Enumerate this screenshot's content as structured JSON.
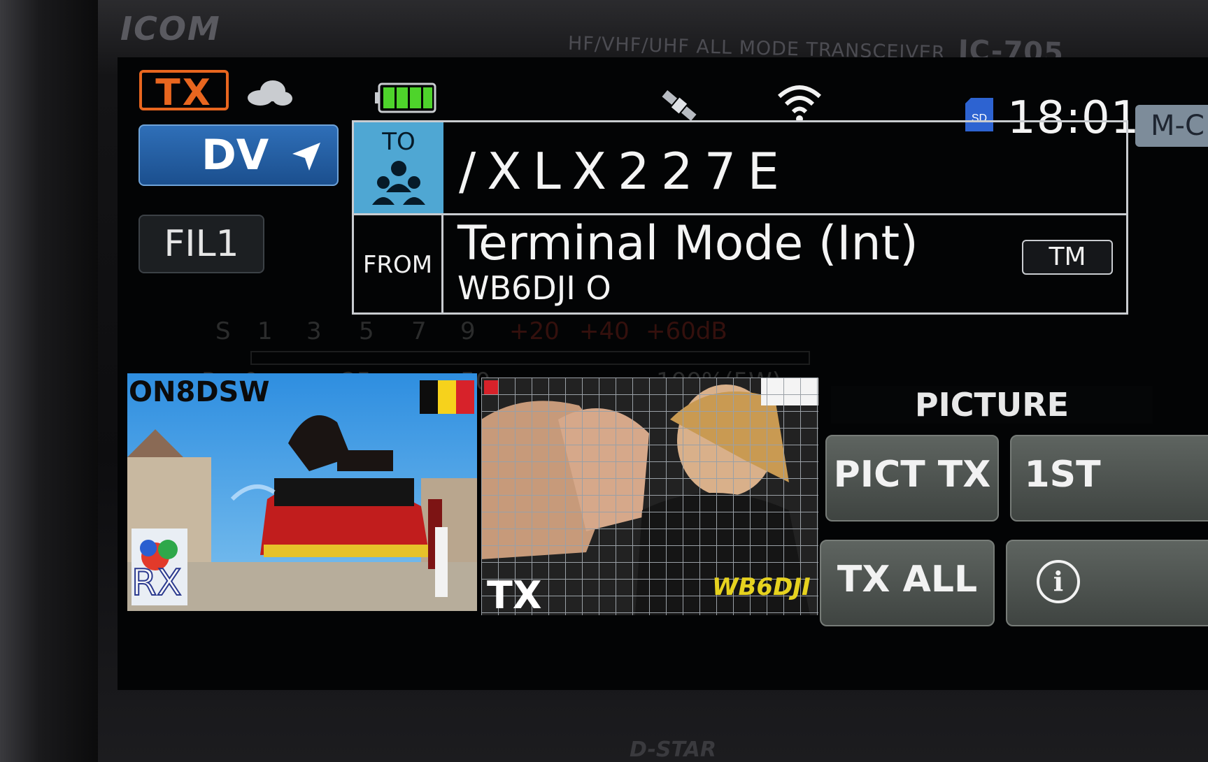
{
  "device": {
    "brand": "ICOM",
    "model_line": "HF/VHF/UHF ALL MODE TRANSCEIVER",
    "model": "IC-705",
    "footer": "D-STAR"
  },
  "status": {
    "tx": "TX",
    "clock": "18:01",
    "sd": "SD",
    "mode_tag": "M-C",
    "battery_level": 1.0
  },
  "controls": {
    "mode": "DV",
    "filter": "FIL1"
  },
  "route": {
    "to_label": "TO",
    "to_value": "/XLX227E",
    "from_label": "FROM",
    "from_name": "Terminal Mode (Int)",
    "from_call": "WB6DJI O",
    "from_tag": "TM"
  },
  "meter": {
    "s_label": "S",
    "s_ticks": [
      "1",
      "3",
      "5",
      "7",
      "9"
    ],
    "db_ticks": [
      "+20",
      "+40",
      "+60dB"
    ],
    "po_label": "Po",
    "po_ticks": [
      "0",
      "25",
      "50",
      "100%(5W)"
    ]
  },
  "images": {
    "rx_call": "ON8DSW",
    "rx_tag": "RX",
    "tx_tag": "TX",
    "tx_call": "WB6DJI"
  },
  "picture_menu": {
    "title": "PICTURE",
    "buttons": [
      "PICT TX",
      "1ST",
      "TX ALL",
      "i"
    ]
  },
  "colors": {
    "tx_orange": "#e8661f",
    "dv_blue": "#2f6fb8",
    "to_blue": "#4fa7d3",
    "meter_red": "#e03a2a"
  }
}
